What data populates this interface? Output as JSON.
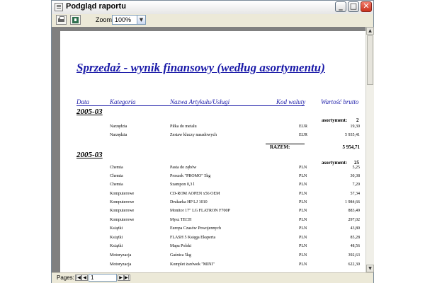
{
  "window": {
    "title": "Podgląd raportu",
    "minimize": "_",
    "maximize": "□",
    "close": "✕"
  },
  "toolbar": {
    "print_icon": "printer-icon",
    "export_icon": "export-icon",
    "zoom_label": "Zoom",
    "zoom_value": "100%",
    "dropdown_arrow": "▼"
  },
  "report": {
    "title": "Sprzedaż - wynik finansowy (według asortymentu)",
    "headers": {
      "data": "Data",
      "kategoria": "Kategoria",
      "nazwa": "Nazwa Artykułu/Usługi",
      "kod_waluty": "Kod waluty",
      "wartosc": "Wartość brutto"
    },
    "groups": [
      {
        "period": "2005-03",
        "count_label": "asortyment:",
        "count": "2",
        "rows": [
          {
            "category": "Narzędzia",
            "name": "Piłka do metalu",
            "currency": "EUR",
            "value": "19,30"
          },
          {
            "category": "Narzędzia",
            "name": "Zestaw kluczy nasadowych",
            "currency": "EUR",
            "value": "5 935,41"
          }
        ],
        "total_label": "RAZEM:",
        "total": "5 954,71"
      },
      {
        "period": "2005-03",
        "count_label": "asortyment:",
        "count": "25",
        "rows": [
          {
            "category": "Chemia",
            "name": "Pasta do zębów",
            "currency": "PLN",
            "value": "5,25"
          },
          {
            "category": "Chemia",
            "name": "Proszek \"PROMO\" 5kg",
            "currency": "PLN",
            "value": "30,38"
          },
          {
            "category": "Chemia",
            "name": "Szampon 0,3 l",
            "currency": "PLN",
            "value": "7,20"
          },
          {
            "category": "Komputerowe",
            "name": "CD-ROM AOPEN x56 OEM",
            "currency": "PLN",
            "value": "57,34"
          },
          {
            "category": "Komputerowe",
            "name": "Drukarka HP LJ 1010",
            "currency": "PLN",
            "value": "1 984,66"
          },
          {
            "category": "Komputerowe",
            "name": "Monitor 17\" LG FLATRON F700P",
            "currency": "PLN",
            "value": "883,49"
          },
          {
            "category": "Komputerowe",
            "name": "Mysz TECH",
            "currency": "PLN",
            "value": "297,02"
          },
          {
            "category": "Książki",
            "name": "Europa Czasów Powojennych",
            "currency": "PLN",
            "value": "43,80"
          },
          {
            "category": "Książki",
            "name": "FLASH 5 Księga Eksperta",
            "currency": "PLN",
            "value": "85,28"
          },
          {
            "category": "Książki",
            "name": "Mapa Polski",
            "currency": "PLN",
            "value": "48,56"
          },
          {
            "category": "Motoryzacja",
            "name": "Gaśnica 5kg",
            "currency": "PLN",
            "value": "392,63"
          },
          {
            "category": "Motoryzacja",
            "name": "Komplet żarówek \"MINI\"",
            "currency": "PLN",
            "value": "622,30"
          }
        ]
      }
    ]
  },
  "statusbar": {
    "pages_label": "Pages:",
    "first": "|◀",
    "prev": "◀",
    "page_value": "1",
    "next": "▶",
    "last": "▶|"
  },
  "scrollbar": {
    "up": "▲",
    "down": "▼"
  },
  "colors": {
    "accent": "#1a1aa8",
    "viewport_bg": "#808080",
    "chrome_bg": "#ece9d8"
  }
}
